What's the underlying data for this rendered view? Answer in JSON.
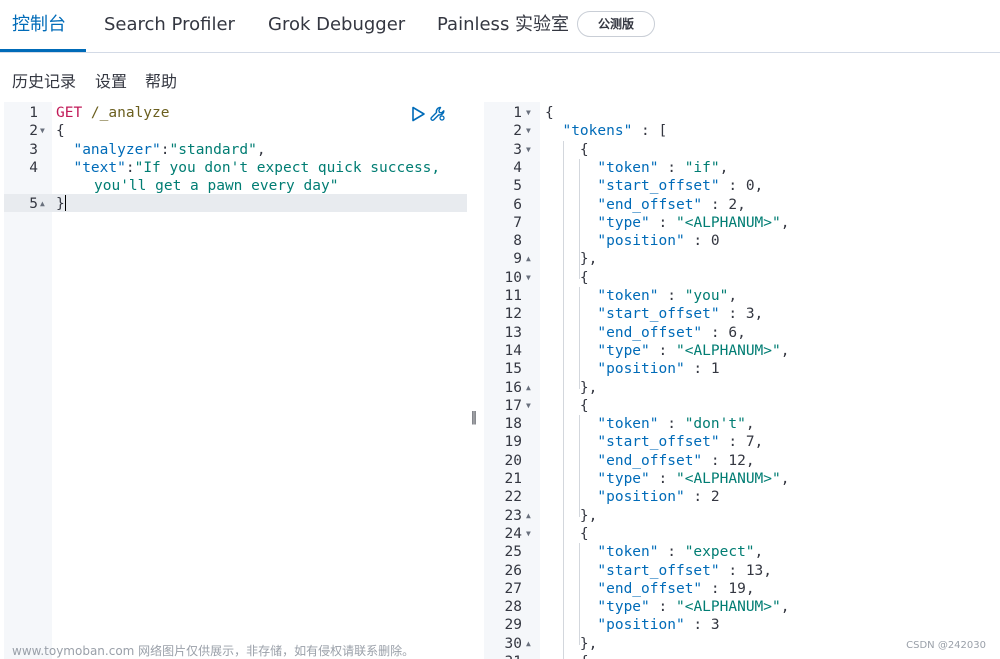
{
  "tabs": [
    {
      "label": "控制台",
      "active": true
    },
    {
      "label": "Search Profiler",
      "active": false
    },
    {
      "label": "Grok Debugger",
      "active": false
    },
    {
      "label": "Painless 实验室",
      "active": false
    }
  ],
  "beta_badge": "公测版",
  "menu": {
    "history": "历史记录",
    "settings": "设置",
    "help": "帮助"
  },
  "request": {
    "method": "GET",
    "path": " /_analyze",
    "line_numbers": [
      "1",
      "2",
      "3",
      "4",
      "5"
    ],
    "analyzer_key": "\"analyzer\"",
    "analyzer_value": "\"standard\"",
    "text_key": "\"text\"",
    "text_value_1": "\"If you don't expect quick success,",
    "text_value_2": "you'll get a pawn every day\""
  },
  "response": {
    "tokens_key": "\"tokens\"",
    "token_entries": [
      {
        "token": "\"if\"",
        "start_offset": "0",
        "end_offset": "2",
        "type": "\"<ALPHANUM>\"",
        "position": "0"
      },
      {
        "token": "\"you\"",
        "start_offset": "3",
        "end_offset": "6",
        "type": "\"<ALPHANUM>\"",
        "position": "1"
      },
      {
        "token": "\"don't\"",
        "start_offset": "7",
        "end_offset": "12",
        "type": "\"<ALPHANUM>\"",
        "position": "2"
      },
      {
        "token": "\"expect\"",
        "start_offset": "13",
        "end_offset": "19",
        "type": "\"<ALPHANUM>\"",
        "position": "3"
      }
    ],
    "keys": {
      "token": "\"token\"",
      "start_offset": "\"start_offset\"",
      "end_offset": "\"end_offset\"",
      "type": "\"type\"",
      "position": "\"position\""
    }
  },
  "resizer_glyph": "‖",
  "watermark": "www.toymoban.com 网络图片仅供展示，非存储，如有侵权请联系删除。",
  "credit": "CSDN @242030",
  "colors": {
    "accent": "#006bb8",
    "method": "#c11a58",
    "string": "#017d73",
    "gutter": "#f5f7fa"
  },
  "icons": {
    "run": "play-triangle-icon",
    "wrench": "wrench-icon"
  }
}
